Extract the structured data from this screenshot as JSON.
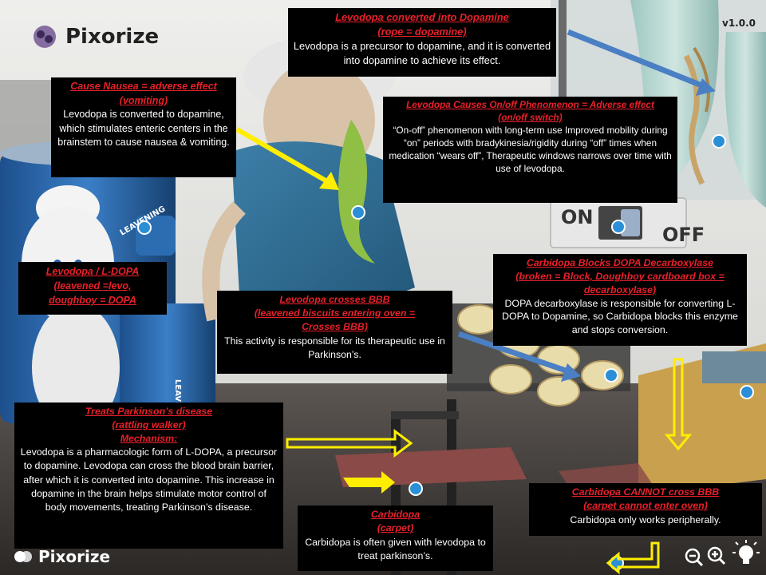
{
  "app": {
    "brand": "Pixorize",
    "version": "v1.0.0",
    "footer_brand": "Pixorize"
  },
  "scene_labels": {
    "on": "ON",
    "off": "OFF",
    "leavening": "LEAVENING",
    "leavening_partial": "LEAVENIN"
  },
  "cards": {
    "dopamine": {
      "title": "Levodopa converted into Dopamine",
      "subtitle": "(rope = dopamine)",
      "body": "Levodopa is a precursor to dopamine, and it is converted into dopamine to achieve its effect."
    },
    "nausea": {
      "title": "Cause Nausea  = adverse effect",
      "subtitle": "(vomiting)",
      "body": "Levodopa is converted to dopamine, which stimulates enteric centers in the brainstem to cause nausea & vomiting."
    },
    "onoff": {
      "title": "Levodopa Causes On/off Phenomenon = Adverse effect",
      "subtitle": "(on/off switch)",
      "body": "“On-off” phenomenon with long-term use Improved mobility during “on” periods with bradykinesia/rigidity during “off” times when medication “wears off”, Therapeutic windows narrows over time with use of levodopa."
    },
    "ldopa": {
      "title": "Levodopa / L-DOPA",
      "subtitle": "(leavened  =levo,",
      "subtitle2": "doughboy  = DOPA"
    },
    "bbb": {
      "title": "Levodopa crosses BBB",
      "subtitle": "(leavened biscuits entering oven =",
      "subtitle2": "Crosses BBB)",
      "body": "This activity is responsible for its therapeutic use in Parkinson’s."
    },
    "decarb": {
      "title": "Carbidopa Blocks DOPA Decarboxylase",
      "subtitle": "(broken = Block, Doughboy cardboard box =",
      "subtitle2": "decarboxylase)",
      "body": "DOPA decarboxylase is responsible for converting L-DOPA to Dopamine, so Carbidopa blocks this enzyme and stops conversion."
    },
    "parkinson": {
      "title": "Treats Parkinson’s disease",
      "subtitle": "(rattling walker)",
      "subtitle2": "Mechanism:",
      "body": "Levodopa is a pharmacologic form of L-DOPA, a precursor to dopamine.  Levodopa can cross the blood brain barrier, after which it is converted into dopamine.  This increase in dopamine in the brain helps stimulate motor  control of body movements, treating Parkinson’s disease."
    },
    "carbidopa": {
      "title": "Carbidopa",
      "subtitle": "(carpet)",
      "body": "Carbidopa is often given with levodopa to treat parkinson’s."
    },
    "carbbbb": {
      "title": "Carbidopa  CANNOT cross BBB",
      "subtitle": "(carpet cannot enter oven)",
      "body": "Carbidopa only works peripherally."
    }
  },
  "colors": {
    "title_red": "#e8202a",
    "card_bg": "#000000",
    "arrow_yellow": "#ffee00",
    "arrow_blue": "#4a7fc4",
    "hotspot_blue": "#2a8fd6"
  },
  "icons": [
    "pixorize-logo-icon",
    "zoom-out-icon",
    "zoom-in-icon",
    "lightbulb-icon"
  ]
}
